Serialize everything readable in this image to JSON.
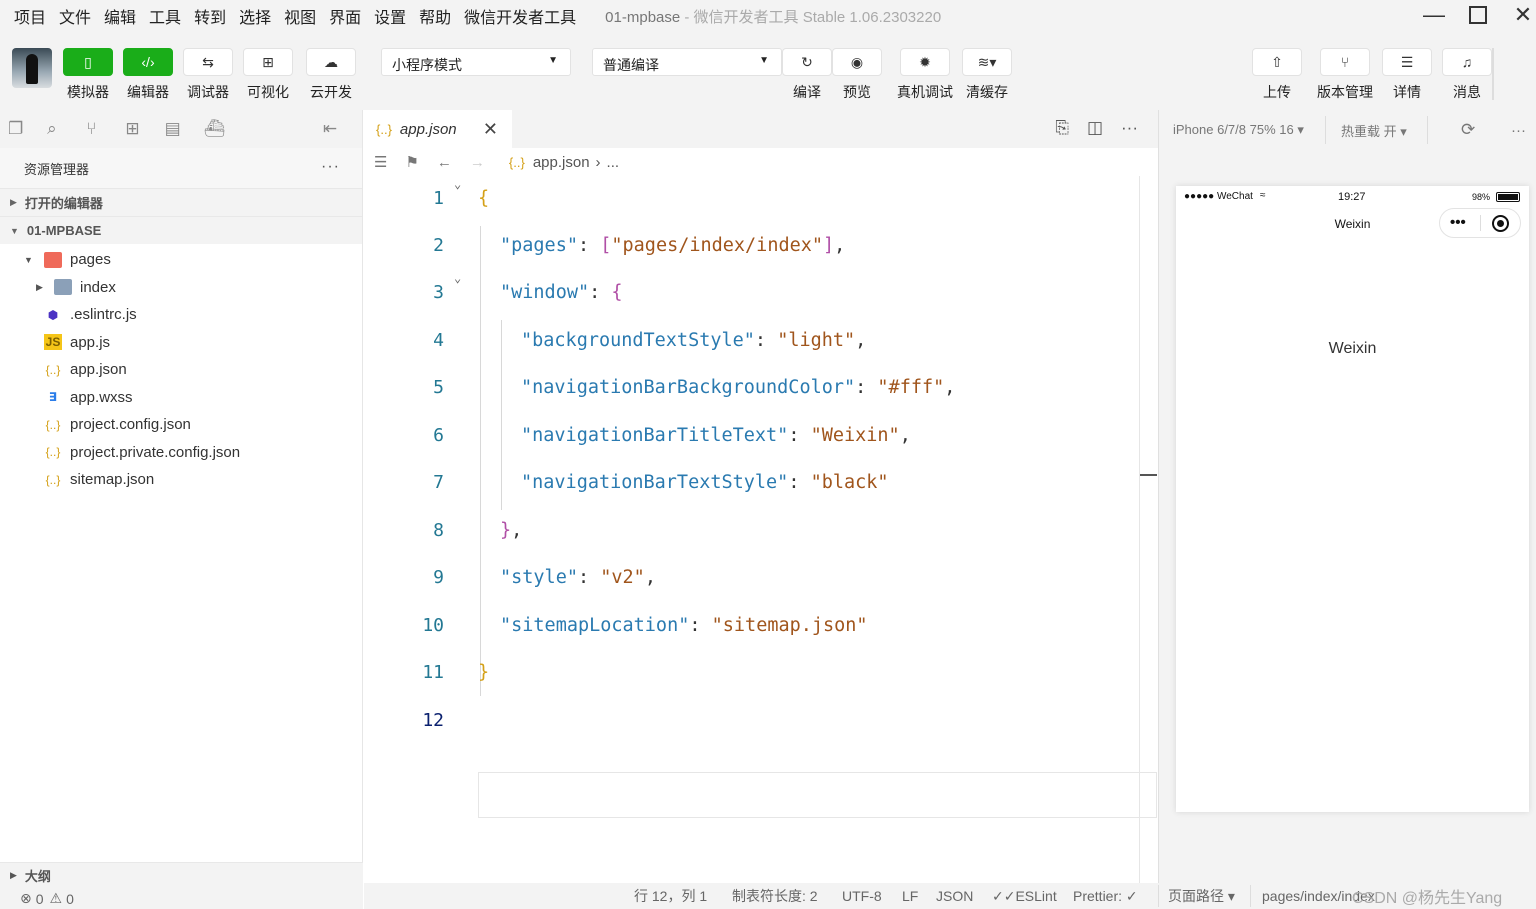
{
  "titlebar": {
    "menu": [
      "项目",
      "文件",
      "编辑",
      "工具",
      "转到",
      "选择",
      "视图",
      "界面",
      "设置",
      "帮助",
      "微信开发者工具"
    ],
    "project": "01-mpbase",
    "app_title": "- 微信开发者工具 Stable 1.06.2303220"
  },
  "toolbar": {
    "simulator": "模拟器",
    "editor": "编辑器",
    "debugger": "调试器",
    "visual": "可视化",
    "cloud": "云开发",
    "mode_select": "小程序模式",
    "compile_select": "普通编译",
    "compile": "编译",
    "preview": "预览",
    "remote_debug": "真机调试",
    "clear_cache": "清缓存",
    "upload": "上传",
    "version": "版本管理",
    "details": "详情",
    "messages": "消息"
  },
  "sidebar": {
    "title": "资源管理器",
    "open_editors": "打开的编辑器",
    "project": "01-MPBASE",
    "tree": [
      {
        "label": "pages",
        "icon": "folder-open-icon"
      },
      {
        "label": "index",
        "icon": "folder-icon"
      },
      {
        "label": ".eslintrc.js",
        "icon": "eslint-icon"
      },
      {
        "label": "app.js",
        "icon": "js-file-icon"
      },
      {
        "label": "app.json",
        "icon": "json-file-icon"
      },
      {
        "label": "app.wxss",
        "icon": "wxss-file-icon"
      },
      {
        "label": "project.config.json",
        "icon": "json-file-icon"
      },
      {
        "label": "project.private.config.json",
        "icon": "json-file-icon"
      },
      {
        "label": "sitemap.json",
        "icon": "json-file-icon"
      }
    ],
    "outline": "大纲",
    "errors": "0",
    "warnings": "0"
  },
  "editor": {
    "tab_name": "app.json",
    "breadcrumb_file": "app.json",
    "breadcrumb_more": "...",
    "lines": [
      "1",
      "2",
      "3",
      "4",
      "5",
      "6",
      "7",
      "8",
      "9",
      "10",
      "11",
      "12"
    ],
    "code": {
      "l2_key": "\"pages\"",
      "l2_val": "\"pages/index/index\"",
      "l3_key": "\"window\"",
      "l4_key": "\"backgroundTextStyle\"",
      "l4_val": "\"light\"",
      "l5_key": "\"navigationBarBackgroundColor\"",
      "l5_val": "\"#fff\"",
      "l6_key": "\"navigationBarTitleText\"",
      "l6_val": "\"Weixin\"",
      "l7_key": "\"navigationBarTextStyle\"",
      "l7_val": "\"black\"",
      "l9_key": "\"style\"",
      "l9_val": "\"v2\"",
      "l10_key": "\"sitemapLocation\"",
      "l10_val": "\"sitemap.json\""
    }
  },
  "statusbar": {
    "position": "行 12，列 1",
    "tab_size": "制表符长度: 2",
    "encoding": "UTF-8",
    "eol": "LF",
    "language": "JSON",
    "eslint": "ESLint",
    "prettier": "Prettier:",
    "page_path_label": "页面路径",
    "page_path": "pages/index/index",
    "watermark": "CSDN @杨先生Yang"
  },
  "simulator": {
    "device": "iPhone 6/7/8 75% 16",
    "hot_reload": "热重载 开",
    "carrier": "●●●●● WeChat",
    "time": "19:27",
    "battery": "98%",
    "nav_title": "Weixin",
    "page_text": "Weixin"
  },
  "colors": {
    "accent": "#1aad19",
    "json_key": "#2a7ab0",
    "json_string": "#a0551c",
    "line_number": "#237893"
  }
}
